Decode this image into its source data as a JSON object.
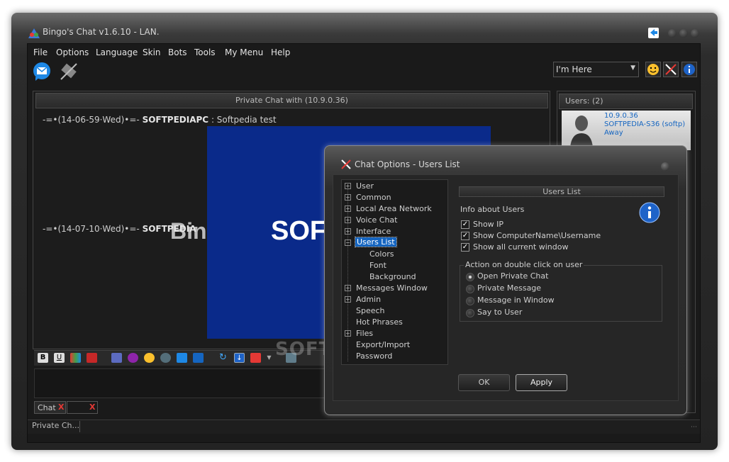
{
  "window": {
    "title": "Bingo's Chat v1.6.10 - LAN."
  },
  "menu": [
    "File",
    "Options",
    "Language",
    "Skin",
    "Bots",
    "Tools",
    "My Menu",
    "Help"
  ],
  "status_combo": {
    "value": "I'm Here"
  },
  "chat_panel": {
    "header": "Private Chat with  (10.9.0.36)",
    "messages": [
      {
        "prefix": "-=•(14-06-59·Wed)•=-",
        "sender": "SOFTPEDIAPC",
        "text": ": Softpedia test"
      },
      {
        "prefix": "-=•(14-07-10·Wed)•=-",
        "sender": "SOFTPEDIA",
        "text": ""
      }
    ],
    "image_text": "SOFT",
    "bingo_text": "Bin"
  },
  "users_panel": {
    "header": "Users: (2)",
    "user": {
      "ip": "10.9.0.36",
      "name": "SOFTPEDIA-S36 (softp)",
      "status": "Away"
    }
  },
  "bottom_tabs": [
    {
      "label": "Chat",
      "close": "X"
    },
    {
      "label": "",
      "close": "X"
    }
  ],
  "statusbar": {
    "text": "Private Ch..."
  },
  "watermark": "SOFTPEDIA",
  "dialog": {
    "title": "Chat Options - Users List",
    "tree": [
      {
        "label": "User",
        "expander": "+"
      },
      {
        "label": "Common",
        "expander": "+"
      },
      {
        "label": "Local Area Network",
        "expander": "+"
      },
      {
        "label": "Voice Chat",
        "expander": "+"
      },
      {
        "label": "Interface",
        "expander": "+"
      },
      {
        "label": "Users List",
        "expander": "−"
      },
      {
        "label": "Colors",
        "expander": ""
      },
      {
        "label": "Font",
        "expander": ""
      },
      {
        "label": "Background",
        "expander": ""
      },
      {
        "label": "Messages Window",
        "expander": "+"
      },
      {
        "label": "Admin",
        "expander": "+"
      },
      {
        "label": "Speech",
        "expander": ""
      },
      {
        "label": "Hot Phrases",
        "expander": ""
      },
      {
        "label": "Files",
        "expander": "+"
      },
      {
        "label": "Export/Import",
        "expander": ""
      },
      {
        "label": "Password",
        "expander": ""
      }
    ],
    "section_title": "Users List",
    "info_label": "Info about Users",
    "checkboxes": [
      {
        "label": "Show IP",
        "checked": true
      },
      {
        "label": "Show ComputerName\\Username",
        "checked": true
      },
      {
        "label": "Show all current window",
        "checked": true
      }
    ],
    "group_label": "Action on double click on user",
    "radios": [
      {
        "label": "Open Private Chat",
        "selected": true
      },
      {
        "label": "Private Message",
        "selected": false
      },
      {
        "label": "Message in Window",
        "selected": false
      },
      {
        "label": "Say to User",
        "selected": false
      }
    ],
    "ok_label": "OK",
    "apply_label": "Apply"
  }
}
